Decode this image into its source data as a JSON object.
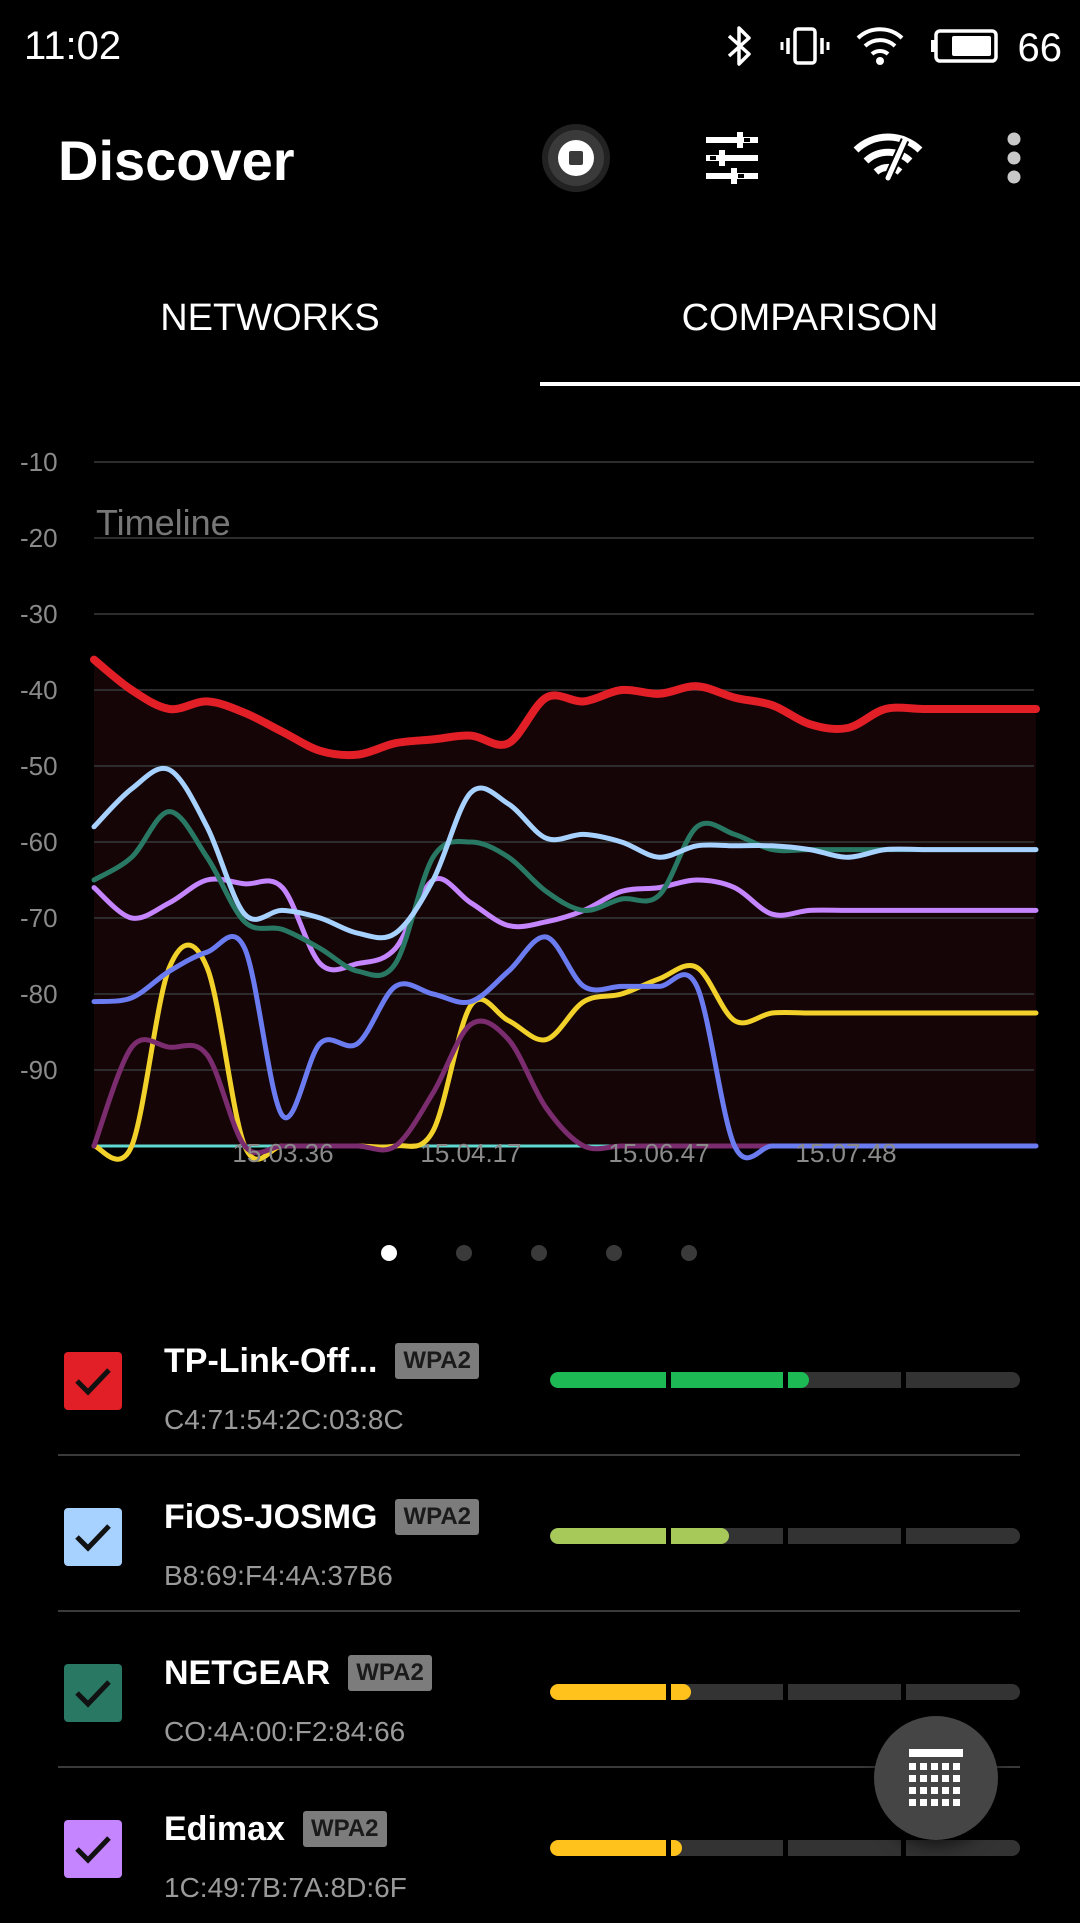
{
  "status_bar": {
    "time": "11:02",
    "battery": "66"
  },
  "app_bar": {
    "title": "Discover",
    "actions": [
      "stop-scan",
      "filter",
      "wifi-signal",
      "more-options"
    ]
  },
  "tabs": [
    {
      "label": "NETWORKS",
      "selected": false
    },
    {
      "label": "COMPARISON",
      "selected": true
    }
  ],
  "chart_data": {
    "type": "line",
    "title": "Timeline",
    "xlabel": "",
    "ylabel": "",
    "ylim": [
      -100,
      -10
    ],
    "yticks": [
      -10,
      -20,
      -30,
      -40,
      -50,
      -60,
      -70,
      -80,
      -90
    ],
    "xticks": [
      "15.03.36",
      "15.04.17",
      "15.06.47",
      "15.07.48"
    ],
    "x": [
      0,
      1,
      2,
      3,
      4,
      5,
      6,
      7,
      8,
      9,
      10,
      11,
      12,
      13,
      14,
      15,
      16,
      17,
      18,
      19,
      20,
      21,
      22,
      23,
      24,
      25
    ],
    "series": [
      {
        "color": "#e21f26",
        "width": 8,
        "values": [
          -36,
          -40,
          -42.5,
          -41.5,
          -43,
          -45.5,
          -48,
          -48.5,
          -47,
          -46.5,
          -46,
          -47,
          -41,
          -41.5,
          -40,
          -40.5,
          -39.5,
          -41,
          -42,
          -44.5,
          -45,
          -42.5,
          -42.5,
          -42.5,
          -42.5,
          -42.5
        ]
      },
      {
        "color": "#a7d1ff",
        "width": 5,
        "values": [
          -58,
          -53,
          -50.5,
          -58,
          -69.5,
          -69,
          -70,
          -72,
          -72,
          -65,
          -53.5,
          -55,
          -59.5,
          -59,
          -60,
          -62,
          -60.5,
          -60.5,
          -60.5,
          -61,
          -62,
          -61,
          -61,
          -61,
          -61,
          -61
        ]
      },
      {
        "color": "#287864",
        "width": 5,
        "values": [
          -65,
          -62,
          -56,
          -62,
          -70.5,
          -71.5,
          -74,
          -77,
          -76,
          -62,
          -60,
          -62,
          -66.5,
          -69,
          -67.5,
          -67,
          -58,
          -59,
          -61,
          -61,
          -61,
          -61,
          -61,
          -61,
          -61,
          -61
        ]
      },
      {
        "color": "#c585ff",
        "width": 5,
        "values": [
          -66,
          -70,
          -68,
          -65,
          -65.5,
          -66,
          -76,
          -76,
          -74,
          -65,
          -68,
          -71,
          -70.5,
          -69,
          -66.5,
          -66,
          -65,
          -66,
          -69.5,
          -69,
          -69,
          -69,
          -69,
          -69,
          -69,
          -69
        ]
      },
      {
        "color": "#6b7bf0",
        "width": 5,
        "values": [
          -81,
          -80.5,
          -77,
          -74.5,
          -74,
          -96,
          -86.5,
          -86.5,
          -79,
          -80,
          -81,
          -77,
          -72.5,
          -79,
          -79,
          -79,
          -79,
          -100,
          -100,
          -100,
          -100,
          -100,
          -100,
          -100,
          -100,
          -100
        ]
      },
      {
        "color": "#7a2c6e",
        "width": 5,
        "values": [
          -100,
          -87,
          -87,
          -88,
          -100,
          -100,
          -100,
          -100,
          -100,
          -93,
          -84,
          -86,
          -95,
          -100,
          -100,
          -100,
          -100,
          -100,
          -100,
          -100,
          -100,
          -100,
          -100,
          -100,
          -100,
          -100
        ]
      },
      {
        "color": "#f2d22a",
        "width": 5,
        "values": [
          -100,
          -100,
          -76.5,
          -76.5,
          -100,
          -100,
          -100,
          -100,
          -100,
          -98,
          -81.5,
          -83.5,
          -86,
          -81,
          -80,
          -78,
          -76.5,
          -83.5,
          -82.5,
          -82.5,
          -82.5,
          -82.5,
          -82.5,
          -82.5,
          -82.5,
          -82.5
        ]
      },
      {
        "color": "#5fd9d0",
        "width": 3,
        "values": [
          -100,
          -100,
          -100,
          -100,
          -100,
          -100,
          -100,
          -100,
          -100,
          -100,
          -100,
          -100,
          -100,
          -100,
          -100,
          -100,
          -100,
          -100,
          -100,
          -100,
          -100,
          -100,
          -100,
          -100,
          -100,
          -100
        ]
      }
    ],
    "grid": true,
    "fill_color": "#150506",
    "legend": "none"
  },
  "pager": {
    "count": 5,
    "active": 0
  },
  "networks": [
    {
      "name": "TP-Link-Off...",
      "security": "WPA2",
      "mac": "C4:71:54:2C:03:8C",
      "color": "#e21f26",
      "checked": true,
      "signal": 0.55,
      "bar_color": "#1db954"
    },
    {
      "name": "FiOS-JOSMG",
      "security": "WPA2",
      "mac": "B8:69:F4:4A:37B6",
      "color": "#a7d1ff",
      "checked": true,
      "signal": 0.38,
      "bar_color": "#a6c95a"
    },
    {
      "name": "NETGEAR",
      "security": "WPA2",
      "mac": "CO:4A:00:F2:84:66",
      "color": "#287864",
      "checked": true,
      "signal": 0.3,
      "bar_color": "#ffc21d"
    },
    {
      "name": "Edimax",
      "security": "WPA2",
      "mac": "1C:49:7B:7A:8D:6F",
      "color": "#c585ff",
      "checked": true,
      "signal": 0.28,
      "bar_color": "#ffc21d"
    }
  ]
}
